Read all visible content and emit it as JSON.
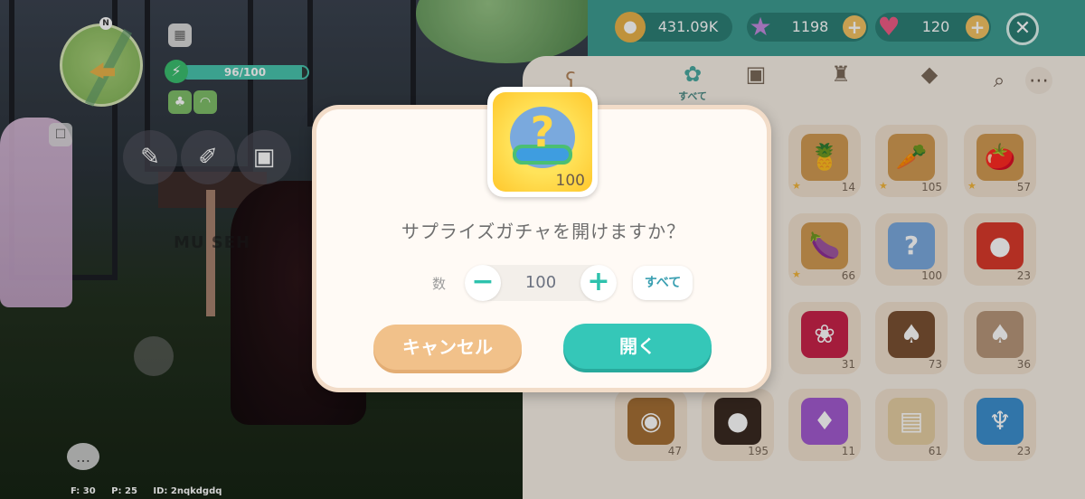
{
  "hud": {
    "minimap_north": "N",
    "stamina_text": "96/100",
    "stamina_fraction": 0.96,
    "icons": [
      "calendar-icon",
      "clover-icon",
      "rainbow-icon",
      "clipboard-icon"
    ],
    "tools": [
      "brush-icon",
      "paint-brush-icon",
      "image-icon"
    ],
    "sign_text": "MU SEH",
    "debug": {
      "fps": "F: 30",
      "ping": "P: 25",
      "id": "ID: 2nqkdgdq"
    }
  },
  "currencies": [
    {
      "name": "coins",
      "icon": "coin-icon",
      "value": "431.09K",
      "color": "#e9b24a"
    },
    {
      "name": "stars",
      "icon": "star-icon",
      "value": "1198",
      "color": "#c38bde"
    },
    {
      "name": "hearts",
      "icon": "heart-icon",
      "value": "120",
      "color": "#ef5c86"
    }
  ],
  "tabs": [
    {
      "icon": "all-icon",
      "label": "すべて",
      "active": true
    },
    {
      "icon": "box-icon",
      "label": ""
    },
    {
      "icon": "furniture-icon",
      "label": ""
    },
    {
      "icon": "shapes-icon",
      "label": ""
    }
  ],
  "inventory": {
    "items": [
      {
        "icon": "pineapple-crate-icon",
        "qty": "14",
        "star": true
      },
      {
        "icon": "carrot-crate-icon",
        "qty": "105",
        "star": true
      },
      {
        "icon": "tomato-crate-icon",
        "qty": "57",
        "star": true
      },
      {
        "icon": "eggplant-crate-icon",
        "qty": "66",
        "star": true
      },
      {
        "icon": "surprise-gacha-icon",
        "qty": "100",
        "star": false
      },
      {
        "icon": "apple-icon",
        "qty": "23",
        "star": false
      },
      {
        "icon": "raspberry-icon",
        "qty": "31",
        "star": false
      },
      {
        "icon": "mushroom-brown-icon",
        "qty": "73",
        "star": false
      },
      {
        "icon": "mushroom-beige-icon",
        "qty": "36",
        "star": false
      },
      {
        "icon": "acorn-icon",
        "qty": "47",
        "star": false
      },
      {
        "icon": "truffle-icon",
        "qty": "195",
        "star": false
      },
      {
        "icon": "perfume-bottle-icon",
        "qty": "11",
        "star": false
      },
      {
        "icon": "seed-bag-icon",
        "qty": "61",
        "star": false
      },
      {
        "icon": "mermaid-tail-icon",
        "qty": "23",
        "star": false
      }
    ]
  },
  "dialog": {
    "item_icon": "surprise-gacha-icon",
    "item_qty": "100",
    "question": "サプライズガチャを開けますか？",
    "qty_label": "数",
    "qty_value": "100",
    "minus": "−",
    "plus": "+",
    "all_label": "すべて",
    "cancel_label": "キャンセル",
    "open_label": "開く"
  }
}
